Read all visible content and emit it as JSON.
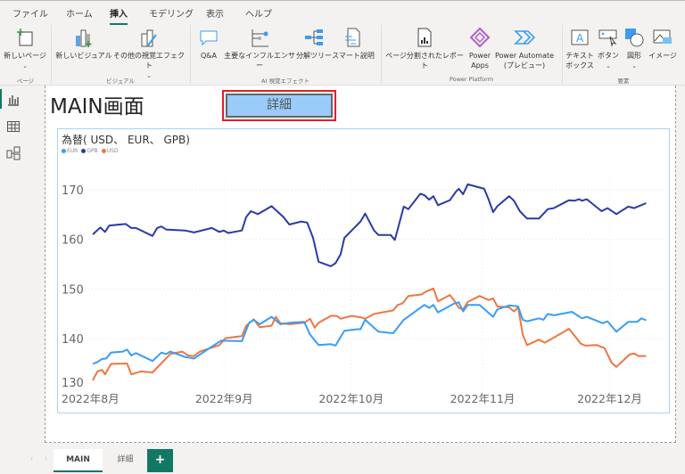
{
  "menu_tabs": [
    "ファイル",
    "ホーム",
    "挿入",
    "モデリング",
    "表示",
    "ヘルプ"
  ],
  "active_tab": "挿入",
  "ribbon": {
    "new_page": "新しいページ",
    "new_visual": "新しいビジュアル",
    "more_visuals": "その他の視覚エフェクト",
    "qa": "Q&A",
    "key_influencers": "主要なインフルエンサー",
    "decomp_tree": "分解ツリー",
    "smart_narrative": "スマート説明",
    "paginated_report": "ページ分割されたレポート",
    "power_apps_1": "Power",
    "power_apps_2": "Apps",
    "power_automate_1": "Power Automate",
    "power_automate_2": "(プレビュー)",
    "textbox_1": "テキスト",
    "textbox_2": "ボックス",
    "button": "ボタン",
    "shapes": "図形",
    "image": "イメージ",
    "groups": {
      "page": "ページ",
      "visual": "ビジュアル",
      "ai": "AI 視覚エフェクト",
      "power_platform": "Power Platform",
      "elements": "要素"
    }
  },
  "page": {
    "title": "MAIN画面",
    "detail_button": "詳細"
  },
  "colors": {
    "EUR": "#3a9df5",
    "GPB": "#2b3aa8",
    "USD": "#ef7640",
    "accent": "#117865"
  },
  "chart_data": {
    "type": "line",
    "title": "為替( USD、 EUR、 GPB)",
    "xlabel": "",
    "ylabel": "",
    "x_unit": "days since 2022-08-01",
    "xlim": [
      0,
      131
    ],
    "ylim": [
      130,
      173
    ],
    "yticks": [
      130,
      140,
      150,
      160,
      170
    ],
    "xticks": [
      {
        "day": 0,
        "label": "2022年8月"
      },
      {
        "day": 31,
        "label": "2022年9月"
      },
      {
        "day": 61,
        "label": "2022年10月"
      },
      {
        "day": 92,
        "label": "2022年11月"
      },
      {
        "day": 122,
        "label": "2022年12月"
      }
    ],
    "legend": [
      "EUR",
      "GPB",
      "USD"
    ],
    "legend_position": "top-left",
    "grid": true,
    "series": [
      {
        "name": "EUR",
        "points": [
          [
            0,
            134.9
          ],
          [
            1.1,
            135.3
          ],
          [
            2.2,
            135.9
          ],
          [
            3.2,
            136
          ],
          [
            4.3,
            137.2
          ],
          [
            7.1,
            137.4
          ],
          [
            8.1,
            137.8
          ],
          [
            9.1,
            136.6
          ],
          [
            10.2,
            137.1
          ],
          [
            14.1,
            135.5
          ],
          [
            16.2,
            137.2
          ],
          [
            17.3,
            136.9
          ],
          [
            18.3,
            137.4
          ],
          [
            21.8,
            136.3
          ],
          [
            23.9,
            136
          ],
          [
            28.1,
            138.4
          ],
          [
            30.3,
            139.6
          ],
          [
            35.2,
            139.5
          ],
          [
            36.9,
            143.2
          ],
          [
            38,
            143.8
          ],
          [
            39.4,
            142.9
          ],
          [
            42.2,
            144.4
          ],
          [
            44.3,
            142.9
          ],
          [
            46.4,
            143.2
          ],
          [
            49.9,
            143.4
          ],
          [
            51.3,
            140.8
          ],
          [
            53.3,
            138.7
          ],
          [
            56.2,
            138.9
          ],
          [
            57.3,
            138.6
          ],
          [
            59.4,
            141.6
          ],
          [
            62.5,
            141.9
          ],
          [
            63.2,
            141.9
          ],
          [
            64.3,
            143.8
          ],
          [
            67.4,
            141.4
          ],
          [
            70.9,
            141.1
          ],
          [
            73.4,
            143.8
          ],
          [
            78.3,
            146.8
          ],
          [
            79.4,
            146.2
          ],
          [
            80.4,
            146.8
          ],
          [
            81.5,
            145.3
          ],
          [
            85.3,
            147.1
          ],
          [
            86.4,
            147.3
          ],
          [
            87.4,
            145.5
          ],
          [
            88.5,
            146.8
          ],
          [
            91.3,
            146.8
          ],
          [
            94.5,
            144.4
          ],
          [
            95.5,
            145.9
          ],
          [
            98.3,
            146.7
          ],
          [
            100.4,
            146.5
          ],
          [
            101.5,
            143.8
          ],
          [
            102.5,
            143.5
          ],
          [
            105.3,
            144.1
          ],
          [
            106.4,
            143.8
          ],
          [
            107.4,
            145
          ],
          [
            108.8,
            144.7
          ],
          [
            113.1,
            145.4
          ],
          [
            115.5,
            144.1
          ],
          [
            116.6,
            144.4
          ],
          [
            120.4,
            143.1
          ],
          [
            121.5,
            143.5
          ],
          [
            123.6,
            141.4
          ],
          [
            126.4,
            143.4
          ],
          [
            128.5,
            143.4
          ],
          [
            129.5,
            144.1
          ],
          [
            130.6,
            143.7
          ]
        ]
      },
      {
        "name": "GPB",
        "points": [
          [
            0,
            161
          ],
          [
            1.8,
            162.4
          ],
          [
            2.9,
            161.5
          ],
          [
            3.9,
            162.8
          ],
          [
            7.8,
            163.1
          ],
          [
            9.1,
            162.3
          ],
          [
            10.2,
            162.3
          ],
          [
            14.1,
            160.7
          ],
          [
            15.2,
            162.3
          ],
          [
            16.2,
            162.6
          ],
          [
            17.3,
            162
          ],
          [
            21.8,
            161.8
          ],
          [
            23.9,
            161.4
          ],
          [
            28.1,
            162.3
          ],
          [
            29.9,
            161.5
          ],
          [
            30.9,
            161.8
          ],
          [
            32,
            161.3
          ],
          [
            35.2,
            161.8
          ],
          [
            36.2,
            164.5
          ],
          [
            37.3,
            165.7
          ],
          [
            39,
            165.1
          ],
          [
            42.2,
            166.7
          ],
          [
            45,
            164.5
          ],
          [
            46.4,
            163
          ],
          [
            49.2,
            163.6
          ],
          [
            50.6,
            163.4
          ],
          [
            52,
            160.3
          ],
          [
            53.3,
            155.5
          ],
          [
            56.2,
            154.6
          ],
          [
            57.3,
            155.2
          ],
          [
            58.5,
            157
          ],
          [
            59.4,
            160.3
          ],
          [
            62.5,
            163
          ],
          [
            63.2,
            163.6
          ],
          [
            64.3,
            165.2
          ],
          [
            66.4,
            161.8
          ],
          [
            67.4,
            160.9
          ],
          [
            70.3,
            160.9
          ],
          [
            71.3,
            159.9
          ],
          [
            73.4,
            166.6
          ],
          [
            74.5,
            166.1
          ],
          [
            77.3,
            169.2
          ],
          [
            78.3,
            168.9
          ],
          [
            79.4,
            168
          ],
          [
            80.4,
            168.7
          ],
          [
            81.5,
            166.9
          ],
          [
            84.3,
            167.9
          ],
          [
            85.7,
            169.6
          ],
          [
            86.4,
            170.2
          ],
          [
            87.4,
            169.1
          ],
          [
            88.5,
            171.1
          ],
          [
            92.4,
            170.2
          ],
          [
            93.4,
            168.1
          ],
          [
            94.5,
            165.5
          ],
          [
            95.5,
            166.7
          ],
          [
            98.3,
            168.7
          ],
          [
            99.4,
            167.8
          ],
          [
            100.8,
            165.7
          ],
          [
            102.5,
            164.2
          ],
          [
            105.3,
            164.2
          ],
          [
            107.4,
            166.1
          ],
          [
            108.8,
            166.3
          ],
          [
            112.4,
            167.9
          ],
          [
            113.7,
            167.8
          ],
          [
            114.8,
            168.1
          ],
          [
            115.5,
            167.8
          ],
          [
            116.6,
            168.1
          ],
          [
            120.1,
            165.7
          ],
          [
            121.5,
            166.3
          ],
          [
            123.6,
            165.1
          ],
          [
            126.4,
            166.6
          ],
          [
            127.8,
            166.3
          ],
          [
            130.6,
            167.3
          ]
        ]
      },
      {
        "name": "USD",
        "points": [
          [
            0,
            131.6
          ],
          [
            1.1,
            133.4
          ],
          [
            2.2,
            133.7
          ],
          [
            2.9,
            132.8
          ],
          [
            4.3,
            134.9
          ],
          [
            8.1,
            135
          ],
          [
            9.1,
            132.8
          ],
          [
            11.3,
            133.4
          ],
          [
            14.1,
            133.2
          ],
          [
            18.3,
            136.9
          ],
          [
            21.1,
            137.4
          ],
          [
            22.5,
            136.6
          ],
          [
            23.9,
            136.5
          ],
          [
            25.3,
            137.4
          ],
          [
            29.9,
            138.7
          ],
          [
            31.3,
            140.1
          ],
          [
            35.2,
            140.5
          ],
          [
            36.2,
            142.6
          ],
          [
            38,
            143.9
          ],
          [
            39.4,
            142.3
          ],
          [
            42.2,
            142.6
          ],
          [
            43.2,
            144.4
          ],
          [
            44.3,
            143.1
          ],
          [
            46.4,
            142.9
          ],
          [
            49.9,
            143.2
          ],
          [
            51.3,
            144
          ],
          [
            52.4,
            142.2
          ],
          [
            53.3,
            143.2
          ],
          [
            56.2,
            144.6
          ],
          [
            57.6,
            144.6
          ],
          [
            58.5,
            144
          ],
          [
            61.1,
            144.6
          ],
          [
            62.5,
            144.4
          ],
          [
            63.2,
            144.3
          ],
          [
            64.3,
            144
          ],
          [
            66.4,
            145
          ],
          [
            70.9,
            145.7
          ],
          [
            72,
            146.8
          ],
          [
            73.1,
            147.1
          ],
          [
            74.5,
            148.6
          ],
          [
            77.6,
            148.9
          ],
          [
            78.7,
            149.5
          ],
          [
            80.4,
            150.1
          ],
          [
            81.5,
            147.5
          ],
          [
            84.3,
            148.8
          ],
          [
            85.3,
            147.7
          ],
          [
            86.4,
            146.2
          ],
          [
            87.4,
            145.9
          ],
          [
            88.5,
            147.4
          ],
          [
            91.3,
            148.6
          ],
          [
            93.4,
            147.8
          ],
          [
            94.5,
            148.1
          ],
          [
            95.5,
            146.5
          ],
          [
            98.3,
            146.3
          ],
          [
            99.4,
            145.5
          ],
          [
            100.4,
            146.3
          ],
          [
            101.5,
            140.8
          ],
          [
            102.5,
            138.7
          ],
          [
            105.3,
            139.8
          ],
          [
            106.7,
            139.2
          ],
          [
            108.8,
            140.2
          ],
          [
            112.4,
            142
          ],
          [
            115.2,
            139
          ],
          [
            116.2,
            138.6
          ],
          [
            119,
            138.7
          ],
          [
            120.8,
            138.1
          ],
          [
            122.5,
            135.1
          ],
          [
            123.6,
            134.3
          ],
          [
            126.7,
            136.8
          ],
          [
            127.8,
            137
          ],
          [
            128.8,
            136.5
          ],
          [
            130.6,
            136.5
          ]
        ]
      }
    ]
  },
  "page_tabs": [
    "MAIN",
    "詳細"
  ],
  "add_page": "+"
}
